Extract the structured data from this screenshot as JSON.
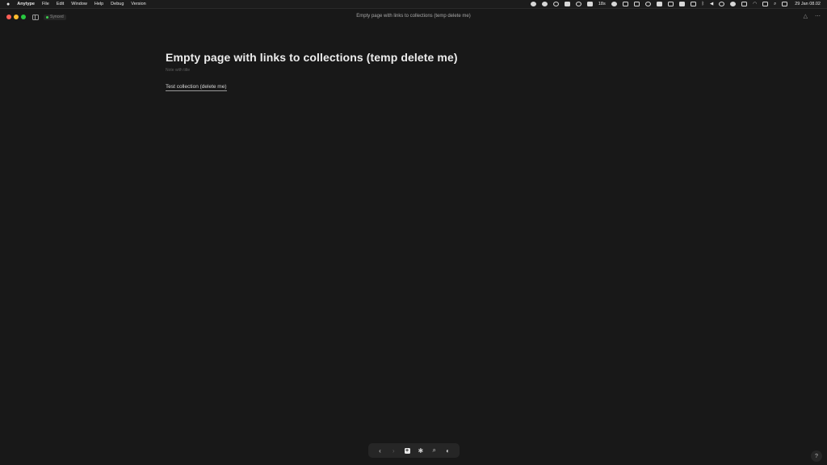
{
  "menubar": {
    "app_name": "Anytype",
    "menus": [
      "File",
      "Edit",
      "Window",
      "Help",
      "Debug",
      "Version"
    ],
    "tray_timer": "18s",
    "clock": "29 Jan  08.02"
  },
  "window": {
    "sync_status": "Synced",
    "title": "Empty page with links to collections (temp delete me)"
  },
  "page": {
    "title": "Empty page with links to collections (temp delete me)",
    "subtitle": "Note with title",
    "link_label": "Test collection (delete me)"
  },
  "bottom_nav": {
    "back_icon": "chevron-left-icon",
    "forward_icon": "chevron-right-icon",
    "add_icon": "plus-icon",
    "graph_icon": "graph-icon",
    "search_icon": "search-icon",
    "space_icon": "space-icon"
  },
  "help_label": "?",
  "colors": {
    "background": "#181818",
    "close": "#ff5f57",
    "minimize": "#febc2e",
    "maximize": "#28c840",
    "synced": "#3ccf4e"
  }
}
